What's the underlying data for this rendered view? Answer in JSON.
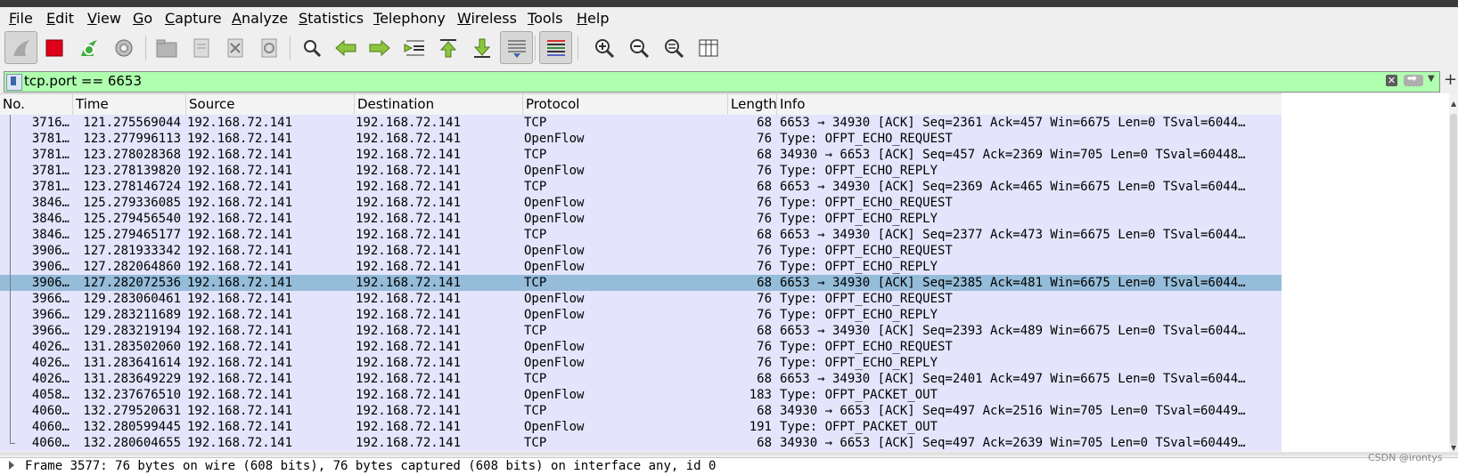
{
  "menu": {
    "items": [
      "File",
      "Edit",
      "View",
      "Go",
      "Capture",
      "Analyze",
      "Statistics",
      "Telephony",
      "Wireless",
      "Tools",
      "Help"
    ]
  },
  "toolbar": {
    "icons": [
      "shark-fin-start-icon",
      "stop-square-icon",
      "restart-capture-icon",
      "capture-options-gear-icon",
      "open-file-icon",
      "save-file-icon",
      "close-file-icon",
      "reload-file-icon",
      "find-packet-icon",
      "go-back-arrow-icon",
      "go-forward-arrow-icon",
      "go-to-packet-icon",
      "go-first-packet-icon",
      "go-last-packet-icon",
      "autoscroll-icon",
      "colorize-icon",
      "zoom-in-icon",
      "zoom-out-icon",
      "normal-size-icon",
      "resize-columns-icon"
    ]
  },
  "filter": {
    "value": "tcp.port == 6653"
  },
  "columns": [
    "No.",
    "Time",
    "Source",
    "Destination",
    "Protocol",
    "Length",
    "Info"
  ],
  "packets": [
    {
      "no": "3716…",
      "time": "121.275569044",
      "src": "192.168.72.141",
      "dst": "192.168.72.141",
      "proto": "TCP",
      "len": "68",
      "info": "6653 → 34930 [ACK] Seq=2361 Ack=457 Win=6675 Len=0 TSval=6044…"
    },
    {
      "no": "3781…",
      "time": "123.277996113",
      "src": "192.168.72.141",
      "dst": "192.168.72.141",
      "proto": "OpenFlow",
      "len": "76",
      "info": "Type: OFPT_ECHO_REQUEST"
    },
    {
      "no": "3781…",
      "time": "123.278028368",
      "src": "192.168.72.141",
      "dst": "192.168.72.141",
      "proto": "TCP",
      "len": "68",
      "info": "34930 → 6653 [ACK] Seq=457 Ack=2369 Win=705 Len=0 TSval=60448…"
    },
    {
      "no": "3781…",
      "time": "123.278139820",
      "src": "192.168.72.141",
      "dst": "192.168.72.141",
      "proto": "OpenFlow",
      "len": "76",
      "info": "Type: OFPT_ECHO_REPLY"
    },
    {
      "no": "3781…",
      "time": "123.278146724",
      "src": "192.168.72.141",
      "dst": "192.168.72.141",
      "proto": "TCP",
      "len": "68",
      "info": "6653 → 34930 [ACK] Seq=2369 Ack=465 Win=6675 Len=0 TSval=6044…"
    },
    {
      "no": "3846…",
      "time": "125.279336085",
      "src": "192.168.72.141",
      "dst": "192.168.72.141",
      "proto": "OpenFlow",
      "len": "76",
      "info": "Type: OFPT_ECHO_REQUEST"
    },
    {
      "no": "3846…",
      "time": "125.279456540",
      "src": "192.168.72.141",
      "dst": "192.168.72.141",
      "proto": "OpenFlow",
      "len": "76",
      "info": "Type: OFPT_ECHO_REPLY"
    },
    {
      "no": "3846…",
      "time": "125.279465177",
      "src": "192.168.72.141",
      "dst": "192.168.72.141",
      "proto": "TCP",
      "len": "68",
      "info": "6653 → 34930 [ACK] Seq=2377 Ack=473 Win=6675 Len=0 TSval=6044…"
    },
    {
      "no": "3906…",
      "time": "127.281933342",
      "src": "192.168.72.141",
      "dst": "192.168.72.141",
      "proto": "OpenFlow",
      "len": "76",
      "info": "Type: OFPT_ECHO_REQUEST"
    },
    {
      "no": "3906…",
      "time": "127.282064860",
      "src": "192.168.72.141",
      "dst": "192.168.72.141",
      "proto": "OpenFlow",
      "len": "76",
      "info": "Type: OFPT_ECHO_REPLY"
    },
    {
      "no": "3906…",
      "time": "127.282072536",
      "src": "192.168.72.141",
      "dst": "192.168.72.141",
      "proto": "TCP",
      "len": "68",
      "info": "6653 → 34930 [ACK] Seq=2385 Ack=481 Win=6675 Len=0 TSval=6044…",
      "selected": true
    },
    {
      "no": "3966…",
      "time": "129.283060461",
      "src": "192.168.72.141",
      "dst": "192.168.72.141",
      "proto": "OpenFlow",
      "len": "76",
      "info": "Type: OFPT_ECHO_REQUEST"
    },
    {
      "no": "3966…",
      "time": "129.283211689",
      "src": "192.168.72.141",
      "dst": "192.168.72.141",
      "proto": "OpenFlow",
      "len": "76",
      "info": "Type: OFPT_ECHO_REPLY"
    },
    {
      "no": "3966…",
      "time": "129.283219194",
      "src": "192.168.72.141",
      "dst": "192.168.72.141",
      "proto": "TCP",
      "len": "68",
      "info": "6653 → 34930 [ACK] Seq=2393 Ack=489 Win=6675 Len=0 TSval=6044…"
    },
    {
      "no": "4026…",
      "time": "131.283502060",
      "src": "192.168.72.141",
      "dst": "192.168.72.141",
      "proto": "OpenFlow",
      "len": "76",
      "info": "Type: OFPT_ECHO_REQUEST"
    },
    {
      "no": "4026…",
      "time": "131.283641614",
      "src": "192.168.72.141",
      "dst": "192.168.72.141",
      "proto": "OpenFlow",
      "len": "76",
      "info": "Type: OFPT_ECHO_REPLY"
    },
    {
      "no": "4026…",
      "time": "131.283649229",
      "src": "192.168.72.141",
      "dst": "192.168.72.141",
      "proto": "TCP",
      "len": "68",
      "info": "6653 → 34930 [ACK] Seq=2401 Ack=497 Win=6675 Len=0 TSval=6044…"
    },
    {
      "no": "4058…",
      "time": "132.237676510",
      "src": "192.168.72.141",
      "dst": "192.168.72.141",
      "proto": "OpenFlow",
      "len": "183",
      "info": "Type: OFPT_PACKET_OUT"
    },
    {
      "no": "4060…",
      "time": "132.279520631",
      "src": "192.168.72.141",
      "dst": "192.168.72.141",
      "proto": "TCP",
      "len": "68",
      "info": "34930 → 6653 [ACK] Seq=497 Ack=2516 Win=705 Len=0 TSval=60449…"
    },
    {
      "no": "4060…",
      "time": "132.280599445",
      "src": "192.168.72.141",
      "dst": "192.168.72.141",
      "proto": "OpenFlow",
      "len": "191",
      "info": "Type: OFPT_PACKET_OUT"
    },
    {
      "no": "4060…",
      "time": "132.280604655",
      "src": "192.168.72.141",
      "dst": "192.168.72.141",
      "proto": "TCP",
      "len": "68",
      "info": "34930 → 6653 [ACK] Seq=497 Ack=2639 Win=705 Len=0 TSval=60449…"
    }
  ],
  "details": {
    "frame_line": "Frame 3577: 76 bytes on wire (608 bits), 76 bytes captured (608 bits) on interface any, id 0"
  },
  "watermark": "CSDN @irontys",
  "colors": {
    "row_bg": "#e4e4fc",
    "selected_bg": "#95bcd9",
    "filter_bg": "#afffaf"
  }
}
